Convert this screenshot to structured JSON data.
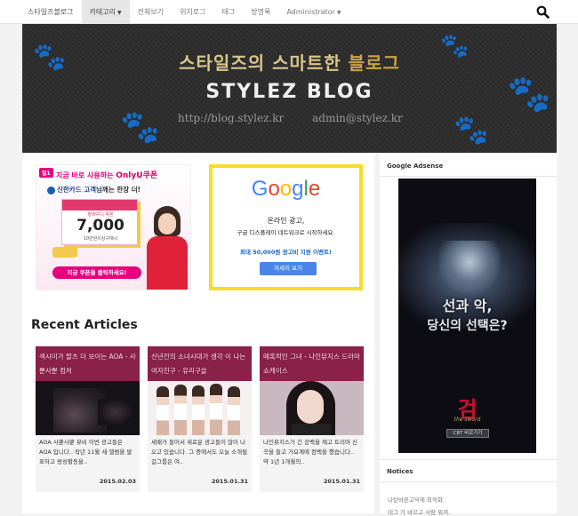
{
  "nav": {
    "brand": "스타일즈블로그",
    "items": [
      {
        "label": "카테고리",
        "dropdown": true,
        "active": true
      },
      {
        "label": "전체보기",
        "dropdown": false,
        "active": false
      },
      {
        "label": "위치로그",
        "dropdown": false,
        "active": false
      },
      {
        "label": "태그",
        "dropdown": false,
        "active": false
      },
      {
        "label": "방명록",
        "dropdown": false,
        "active": false
      },
      {
        "label": "Administrator",
        "dropdown": true,
        "active": false
      }
    ],
    "search_icon": "search-icon"
  },
  "banner": {
    "title_kr_main": "스타일즈의 스마트한",
    "title_kr_accent": "블로그",
    "title_en": "STYLEZ BLOG",
    "url": "http://blog.stylez.kr",
    "email": "admin@stylez.kr"
  },
  "ad_coupon": {
    "badge": "일1",
    "headline_a": "지금 바로 사용하는",
    "headline_b": "OnlyU쿠폰",
    "card_line_a": "신한카드 고객님",
    "card_line_b": "께는 한장 더!",
    "coupon_label": "장바구니 쿠폰",
    "coupon_value": "7,000",
    "coupon_sub": "10만원이상구매시",
    "cta": "지금 쿠폰을 클릭하세요!"
  },
  "ad_google": {
    "logo": "Google",
    "line1": "온라인 광고,",
    "line2": "구글 디스플레이 네트워크로 시작하세요.",
    "promo": "최대 50,000원 광고비 지원 이벤트!",
    "button": "자세히 보기"
  },
  "recent": {
    "heading": "Recent Articles",
    "articles": [
      {
        "title": "섹시미가 팔츠 더 보이는 AOA - 사뿐사뿐 컴처",
        "excerpt": "AOA 사뿐사뿐 뮤비 이번 광고들은 AOA 입니다.. 작년 11월 새 앨범을 발표하고 왕성활동을..",
        "date": "2015.02.03"
      },
      {
        "title": "신년전의 소녀시대가 생각 이 나는 여자친구 - 유리구슬",
        "excerpt": "세배가 들어서 새로운 광고들이 많이 나오고 있습니다. 그 중에서도 오늘 소개될 걸그룹은 여..",
        "date": "2015.01.31"
      },
      {
        "title": "매혹적인 그녀 - 나인뮤지스 드라마 쇼케이스",
        "excerpt": "나인뮤지스가 긴 공백을 깨고 트리머 신곡을 들고 가요계에 컴백을 했습니다.. 약 1년 1개월의..",
        "date": "2015.01.31"
      }
    ]
  },
  "sidebar": {
    "adsense_title": "Google Adsense",
    "ad_line1": "선과 악,",
    "ad_line2": "당신의 선택은?",
    "ad_logo": "검",
    "ad_logo_sub": "the sword",
    "ad_button": "CBT 바로가기",
    "notices_title": "Notices",
    "notices": [
      "나탄바른고딕에 최적화.",
      "태그 가 바르고 사람 뭐져."
    ]
  },
  "colors": {
    "accent_pink": "#8a2148",
    "banner_gold": "#d8c58a",
    "google_border": "#f7dc2a"
  }
}
